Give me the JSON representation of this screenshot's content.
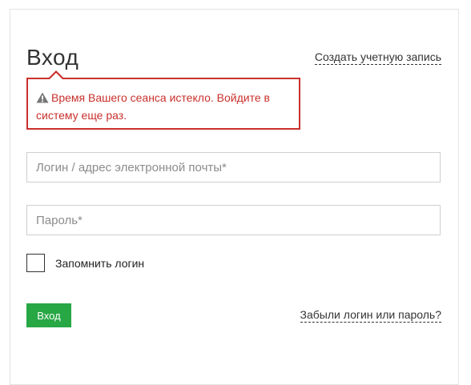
{
  "login_form": {
    "title": "Вход",
    "create_account_link": "Создать учетную запись",
    "alert": {
      "icon": "warning-icon",
      "message": "Время Вашего сеанса истекло. Войдите в систему еще раз.",
      "color": "#c9302c"
    },
    "login_field": {
      "value": "",
      "placeholder": "Логин / адрес электронной почты*"
    },
    "password_field": {
      "value": "",
      "placeholder": "Пароль*"
    },
    "remember": {
      "label": "Запомнить логин",
      "checked": false
    },
    "submit_label": "Вход",
    "submit_color": "#28a745",
    "forgot_link": "Забыли логин или пароль?"
  }
}
